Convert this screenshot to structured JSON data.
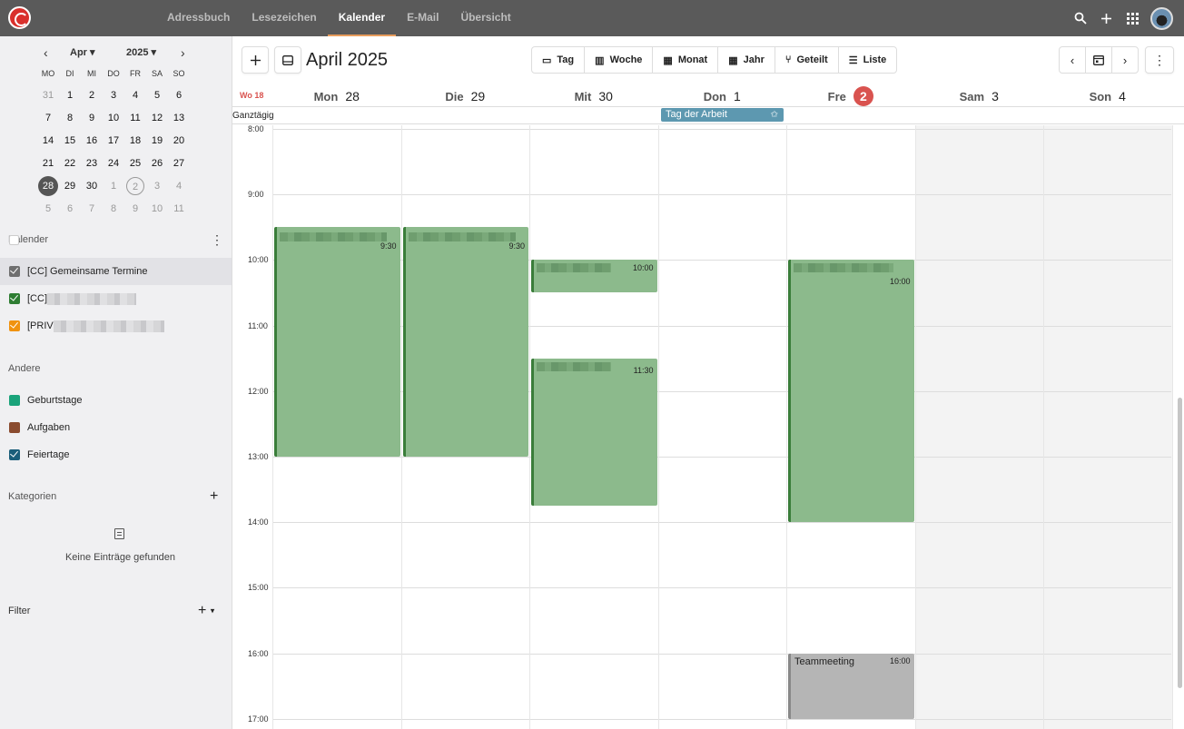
{
  "topnav": {
    "tabs": [
      {
        "label": "Adressbuch"
      },
      {
        "label": "Lesezeichen"
      },
      {
        "label": "Kalender"
      },
      {
        "label": "E-Mail"
      },
      {
        "label": "Übersicht"
      }
    ],
    "active": "Kalender"
  },
  "mini_calendar": {
    "month": "Apr",
    "year": "2025",
    "weekdays": [
      "MO",
      "DI",
      "MI",
      "DO",
      "FR",
      "SA",
      "SO"
    ],
    "weeks": [
      [
        "31",
        "1",
        "2",
        "3",
        "4",
        "5",
        "6"
      ],
      [
        "7",
        "8",
        "9",
        "10",
        "11",
        "12",
        "13"
      ],
      [
        "14",
        "15",
        "16",
        "17",
        "18",
        "19",
        "20"
      ],
      [
        "21",
        "22",
        "23",
        "24",
        "25",
        "26",
        "27"
      ],
      [
        "28",
        "29",
        "30",
        "1",
        "2",
        "3",
        "4"
      ],
      [
        "5",
        "6",
        "7",
        "8",
        "9",
        "10",
        "11"
      ]
    ]
  },
  "sidebar": {
    "kalender_title": "Kalender",
    "calendars": [
      {
        "label": "[CC] Gemeinsame Termine",
        "color": "#6f6f6f"
      },
      {
        "label": "[CC]",
        "color": "#2e7d32"
      },
      {
        "label": "[PRIV",
        "color": "#f0920f"
      }
    ],
    "andere_title": "Andere",
    "others": [
      {
        "label": "Geburtstage",
        "color": "#1aa37a"
      },
      {
        "label": "Aufgaben",
        "color": "#8a4b2f"
      },
      {
        "label": "Feiertage",
        "color": "#1b5e7a"
      }
    ],
    "kategorien_title": "Kategorien",
    "empty_text": "Keine Einträge gefunden",
    "filter_title": "Filter"
  },
  "toolbar": {
    "title": "April 2025",
    "views": [
      {
        "label": "Tag",
        "icon": "▭"
      },
      {
        "label": "Woche",
        "icon": "▥"
      },
      {
        "label": "Monat",
        "icon": "▦"
      },
      {
        "label": "Jahr",
        "icon": "▦"
      },
      {
        "label": "Geteilt",
        "icon": "⑂"
      },
      {
        "label": "Liste",
        "icon": "☰"
      }
    ]
  },
  "week": {
    "label": "Wo 18",
    "days": [
      {
        "name": "Mon",
        "num": "28"
      },
      {
        "name": "Die",
        "num": "29"
      },
      {
        "name": "Mit",
        "num": "30"
      },
      {
        "name": "Don",
        "num": "1"
      },
      {
        "name": "Fre",
        "num": "2"
      },
      {
        "name": "Sam",
        "num": "3"
      },
      {
        "name": "Son",
        "num": "4"
      }
    ],
    "allday_label": "Ganztägig",
    "holiday": "Tag der Arbeit",
    "hours": [
      "8:00",
      "9:00",
      "10:00",
      "11:00",
      "12:00",
      "13:00",
      "14:00",
      "15:00",
      "16:00",
      "17:00"
    ]
  },
  "events": [
    {
      "day": 0,
      "time": "9:30"
    },
    {
      "day": 1,
      "time": "9:30"
    },
    {
      "day": 2,
      "time": "10:00"
    },
    {
      "day": 2,
      "time": "11:30"
    },
    {
      "day": 4,
      "time": "10:00"
    },
    {
      "day": 4,
      "time": "16:00",
      "title": "Teammeeting"
    }
  ]
}
